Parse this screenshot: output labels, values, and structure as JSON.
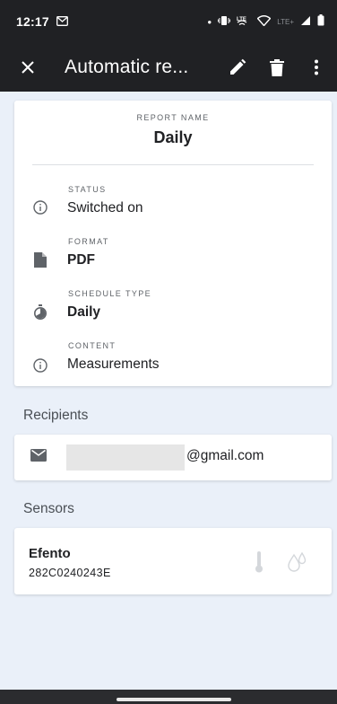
{
  "status_bar": {
    "time": "12:17",
    "mail_glyph": "M",
    "lte_label": "LTE",
    "lte_dim_label": "LTE+"
  },
  "app_bar": {
    "title": "Automatic re..."
  },
  "report": {
    "report_name_label": "REPORT NAME",
    "report_name_value": "Daily",
    "properties": [
      {
        "label": "STATUS",
        "value": "Switched on",
        "icon": "info-circle-icon",
        "bold": false
      },
      {
        "label": "FORMAT",
        "value": "PDF",
        "icon": "file-icon",
        "bold": true
      },
      {
        "label": "SCHEDULE TYPE",
        "value": "Daily",
        "icon": "timer-icon",
        "bold": true
      },
      {
        "label": "CONTENT",
        "value": "Measurements",
        "icon": "info-circle-icon",
        "bold": false
      }
    ]
  },
  "recipients": {
    "header": "Recipients",
    "email_suffix": "@gmail.com"
  },
  "sensors": {
    "header": "Sensors",
    "items": [
      {
        "name": "Efento",
        "id": "282C0240243E"
      }
    ]
  },
  "colors": {
    "app_bar_bg": "#202124",
    "page_bg": "#eaf0f9",
    "card_bg": "#ffffff",
    "icon_gray": "#5f6368",
    "disabled_icon": "#cfd2d6"
  }
}
